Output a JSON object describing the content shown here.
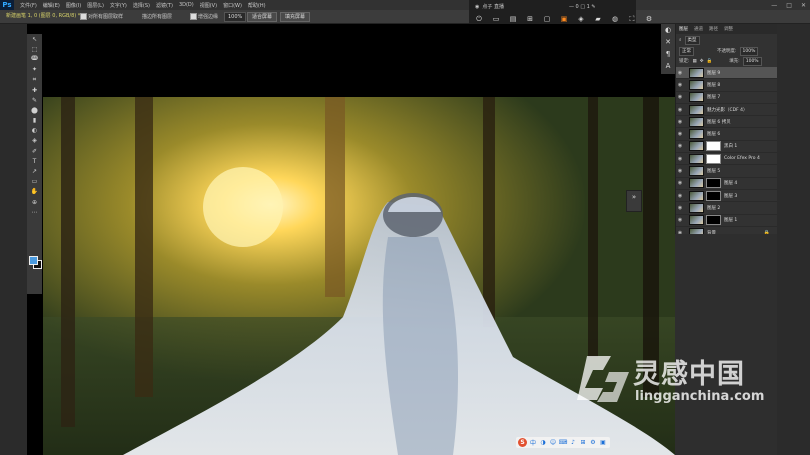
{
  "app": {
    "logo_text": "Ps",
    "menu": [
      "文件(F)",
      "编辑(E)",
      "图像(I)",
      "图层(L)",
      "文字(Y)",
      "选择(S)",
      "滤镜(T)",
      "3D(D)",
      "视图(V)",
      "窗口(W)",
      "帮助(H)"
    ],
    "window_controls": [
      "—",
      "□",
      "✕"
    ]
  },
  "document_tab": "新建画笔 1, 0 (图层 0, RGB/8) *",
  "options_bar": {
    "sample_all_label": "对所有图层取样",
    "sample_checked": true,
    "blend_label": "描边所有图层",
    "enhance_label": "增强边缘",
    "zoom_value": "100%",
    "btn_fit_screen": "适合屏幕",
    "btn_fill_screen": "填充屏幕"
  },
  "float_toolbar": {
    "title": "点子 直播",
    "status": "— 0 □ 1 ✎",
    "icons": [
      "power-icon",
      "chat-icon",
      "doc-icon",
      "gift-icon",
      "cup-icon",
      "crop-icon",
      "tag-icon",
      "lock-icon",
      "user-icon",
      "fullscreen-icon",
      "settings-icon"
    ]
  },
  "tools": [
    "↖",
    "⬚",
    "ↈ",
    "✦",
    "⌗",
    "✚",
    "✎",
    "⬤",
    "▮",
    "◐",
    "◈",
    "✐",
    "T",
    "↗",
    "▭",
    "✋",
    "⊕",
    "⋯"
  ],
  "layers_panel": {
    "tabs": [
      "图层",
      "通道",
      "路径",
      "调整"
    ],
    "kind_label": "类型",
    "blend_mode": "正常",
    "opacity_label": "不透明度:",
    "opacity_value": "100%",
    "lock_label": "锁定:",
    "fill_label": "填充:",
    "fill_value": "100%",
    "layers": [
      {
        "name": "图层 9",
        "selected": true,
        "mask": ""
      },
      {
        "name": "图层 8",
        "selected": false,
        "mask": ""
      },
      {
        "name": "图层 7",
        "selected": false,
        "mask": ""
      },
      {
        "name": "魅力光影（CDF 4）",
        "selected": false,
        "mask": ""
      },
      {
        "name": "图层 6 拷贝",
        "selected": false,
        "mask": ""
      },
      {
        "name": "图层 6",
        "selected": false,
        "mask": ""
      },
      {
        "name": "黑白 1",
        "selected": false,
        "mask": "white"
      },
      {
        "name": "Color Efex Pro 4",
        "selected": false,
        "mask": "white"
      },
      {
        "name": "图层 5",
        "selected": false,
        "mask": ""
      },
      {
        "name": "图层 4",
        "selected": false,
        "mask": "black"
      },
      {
        "name": "图层 3",
        "selected": false,
        "mask": "black"
      },
      {
        "name": "图层 2",
        "selected": false,
        "mask": ""
      },
      {
        "name": "图层 1",
        "selected": false,
        "mask": "black"
      },
      {
        "name": "背景",
        "selected": false,
        "mask": ""
      }
    ],
    "background_lock": "🔒"
  },
  "watermark": {
    "cn": "灵感中国",
    "en": "lingganchina.com"
  },
  "ime": {
    "logo": "S",
    "icons": [
      "中",
      "◑",
      "☺",
      "⌨",
      "♪",
      "⊞",
      "⚙",
      "▣"
    ]
  },
  "colors": {
    "accent": "#ff8a1f",
    "fg_color": "#4b9be0",
    "bg_color": "#111111"
  }
}
